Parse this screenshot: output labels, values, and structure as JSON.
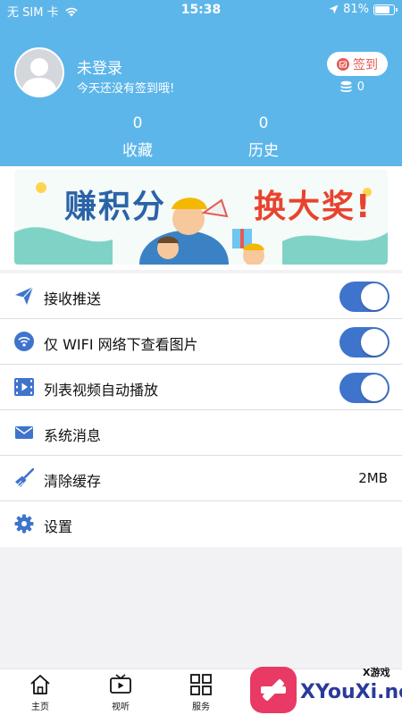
{
  "status_bar": {
    "carrier": "无 SIM 卡",
    "time": "15:38",
    "battery_percent": "81%",
    "battery_level": 0.81
  },
  "profile": {
    "name": "未登录",
    "tip": "今天还没有签到哦!",
    "signin_label": "签到",
    "coins": "0"
  },
  "stats": [
    {
      "count": "0",
      "label": "收藏"
    },
    {
      "count": "0",
      "label": "历史"
    }
  ],
  "banner": {
    "text_left": "赚积分",
    "text_right": "换大奖!"
  },
  "settings": [
    {
      "icon": "paper-plane-icon",
      "label": "接收推送",
      "toggle": true
    },
    {
      "icon": "wifi-icon",
      "label": "仅 WIFI 网络下查看图片",
      "toggle": true
    },
    {
      "icon": "video-icon",
      "label": "列表视频自动播放",
      "toggle": true
    },
    {
      "icon": "mail-icon",
      "label": "系统消息"
    },
    {
      "icon": "broom-icon",
      "label": "清除缓存",
      "value": "2MB"
    },
    {
      "icon": "gear-icon",
      "label": "设置"
    }
  ],
  "tabbar": [
    {
      "icon": "home-icon",
      "label": "主页"
    },
    {
      "icon": "tv-icon",
      "label": "视听"
    },
    {
      "icon": "grid-icon",
      "label": "服务"
    }
  ],
  "watermark": {
    "top": "X游戏",
    "main": "XYouXi.net"
  },
  "colors": {
    "header": "#5db6ea",
    "accent": "#3f74cc",
    "signin": "#e45b55"
  }
}
